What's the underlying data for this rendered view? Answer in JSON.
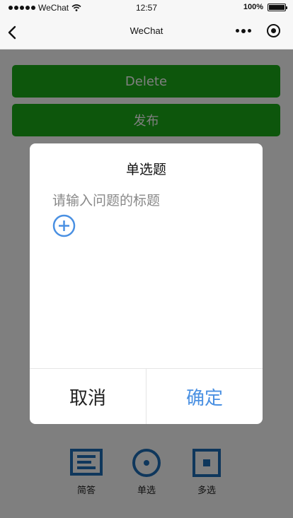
{
  "status_bar": {
    "carrier": "WeChat",
    "time": "12:57",
    "battery": "100%"
  },
  "nav": {
    "title": "WeChat",
    "back_icon": "back-chevron-icon",
    "more_icon": "more-dots-icon",
    "close_icon": "target-circle-icon"
  },
  "page": {
    "delete_label": "Delete",
    "publish_label": "发布"
  },
  "toolbar": {
    "items": [
      {
        "label": "简答",
        "icon": "short-answer-icon"
      },
      {
        "label": "单选",
        "icon": "single-choice-icon"
      },
      {
        "label": "多选",
        "icon": "multi-choice-icon"
      }
    ]
  },
  "modal": {
    "title": "单选题",
    "input_placeholder": "请输入问题的标题",
    "input_value": "",
    "add_icon": "plus-circle-icon",
    "cancel_label": "取消",
    "confirm_label": "确定"
  },
  "colors": {
    "primary_green": "#1aad19",
    "confirm_blue": "#4a90e2",
    "toolbar_icon": "#1e6fb8",
    "mask": "rgba(0,0,0,0.5)"
  }
}
